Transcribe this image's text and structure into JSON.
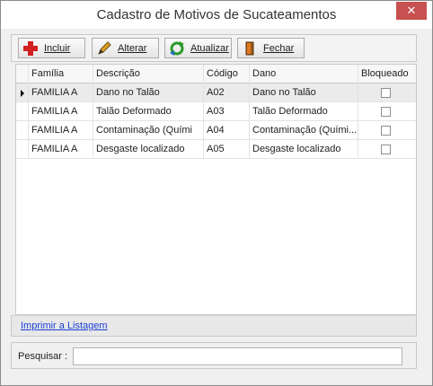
{
  "window": {
    "title": "Cadastro de Motivos de Sucateamentos",
    "close_label": "✕"
  },
  "toolbar": {
    "buttons": [
      {
        "label": "Incluir",
        "icon": "add-icon"
      },
      {
        "label": "Alterar",
        "icon": "pencil-icon"
      },
      {
        "label": "Atualizar",
        "icon": "refresh-icon"
      },
      {
        "label": "Fechar",
        "icon": "exit-door-icon"
      }
    ]
  },
  "grid": {
    "columns": [
      "Família",
      "Descrição",
      "Código",
      "Dano",
      "Bloqueado"
    ],
    "rows": [
      {
        "familia": "FAMILIA A",
        "descricao": "Dano no Talão",
        "codigo": "A02",
        "dano": "Dano no Talão",
        "bloqueado": false
      },
      {
        "familia": "FAMILIA A",
        "descricao": "Talão Deformado",
        "codigo": "A03",
        "dano": "Talão Deformado",
        "bloqueado": false
      },
      {
        "familia": "FAMILIA A",
        "descricao": "Contaminação (Quími",
        "codigo": "A04",
        "dano": "Contaminação (Quími...",
        "bloqueado": false
      },
      {
        "familia": "FAMILIA A",
        "descricao": "Desgaste localizado",
        "codigo": "A05",
        "dano": "Desgaste localizado",
        "bloqueado": false
      }
    ]
  },
  "footer": {
    "print_link": "Imprimir a Listagem"
  },
  "search": {
    "label": "Pesquisar :",
    "value": ""
  },
  "colors": {
    "close": "#c75050",
    "link": "#1a3fd6",
    "selected_row": "#ebebeb"
  }
}
